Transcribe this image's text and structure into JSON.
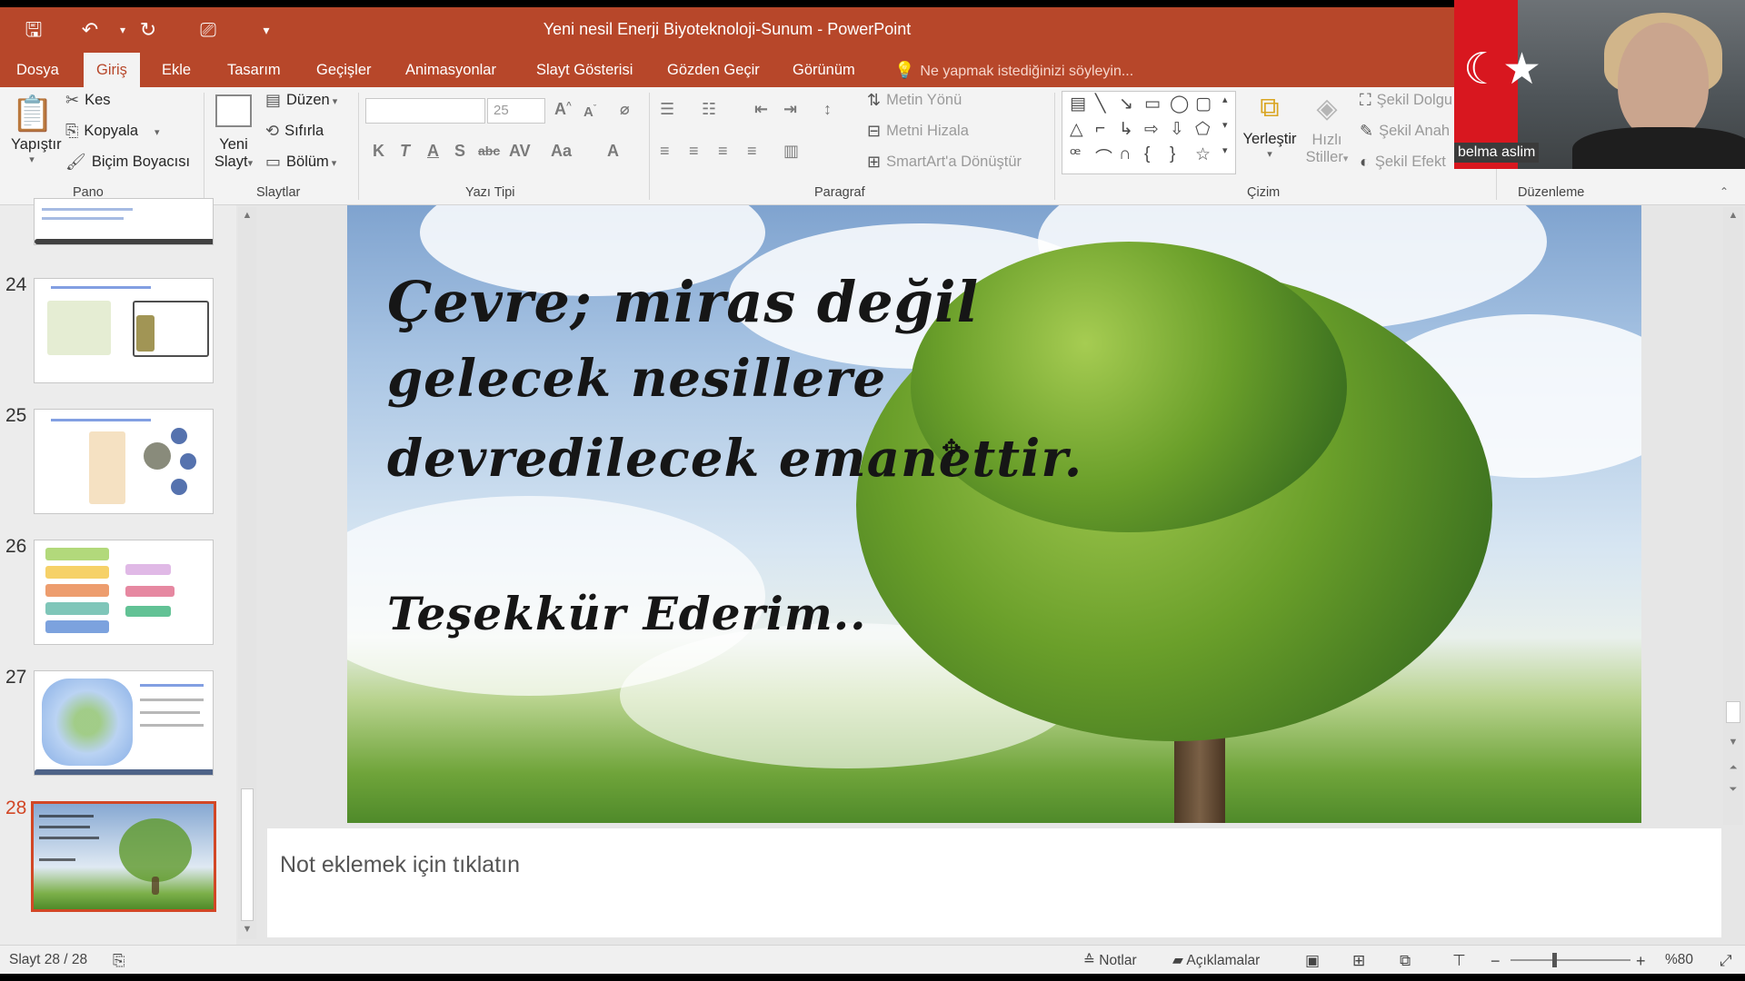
{
  "window": {
    "title": "Yeni nesil Enerji Biyoteknoloji-Sunum - PowerPoint",
    "accent": "#b7472a"
  },
  "qat": {
    "icons": [
      "save-icon",
      "undo-icon",
      "redo-icon",
      "present-icon",
      "customize-icon"
    ]
  },
  "tabs": [
    "Dosya",
    "Giriş",
    "Ekle",
    "Tasarım",
    "Geçişler",
    "Animasyonlar",
    "Slayt Gösterisi",
    "Gözden Geçir",
    "Görünüm"
  ],
  "active_tab": "Giriş",
  "tellme": "Ne yapmak istediğinizi söyleyin...",
  "ribbon": {
    "pano": {
      "label": "Pano",
      "paste": "Yapıştır",
      "cut": "Kes",
      "copy": "Kopyala",
      "format_painter": "Biçim Boyacısı"
    },
    "slaytlar": {
      "label": "Slaytlar",
      "new_slide_1": "Yeni",
      "new_slide_2": "Slayt",
      "layout": "Düzen",
      "reset": "Sıfırla",
      "section": "Bölüm"
    },
    "yazi_tipi": {
      "label": "Yazı Tipi",
      "font_name": "",
      "font_size": "25"
    },
    "paragraf": {
      "label": "Paragraf",
      "text_direction": "Metin Yönü",
      "align_text": "Metni Hizala",
      "smartart": "SmartArt'a Dönüştür"
    },
    "cizim": {
      "label": "Çizim",
      "arrange": "Yerleştir",
      "quick_styles_1": "Hızlı",
      "quick_styles_2": "Stiller",
      "shape_fill": "Şekil Dolgu",
      "shape_outline": "Şekil Anah",
      "shape_effects": "Şekil Efekt"
    },
    "duzenleme": {
      "label": "Düzenleme"
    }
  },
  "webcam": {
    "name": "belma aslim"
  },
  "slides": [
    {
      "number": "24"
    },
    {
      "number": "25"
    },
    {
      "number": "26"
    },
    {
      "number": "27"
    },
    {
      "number": "28",
      "selected": true
    }
  ],
  "current_slide": {
    "line1": "Çevre; miras değil",
    "line2": "gelecek nesillere",
    "line3": "devredilecek emanettir.",
    "thanks": "Teşekkür Ederim.."
  },
  "notes": {
    "placeholder": "Not eklemek için tıklatın"
  },
  "statusbar": {
    "slide_counter": "Slayt 28 / 28",
    "notes": "Notlar",
    "comments": "Açıklamalar",
    "zoom": "%80"
  }
}
